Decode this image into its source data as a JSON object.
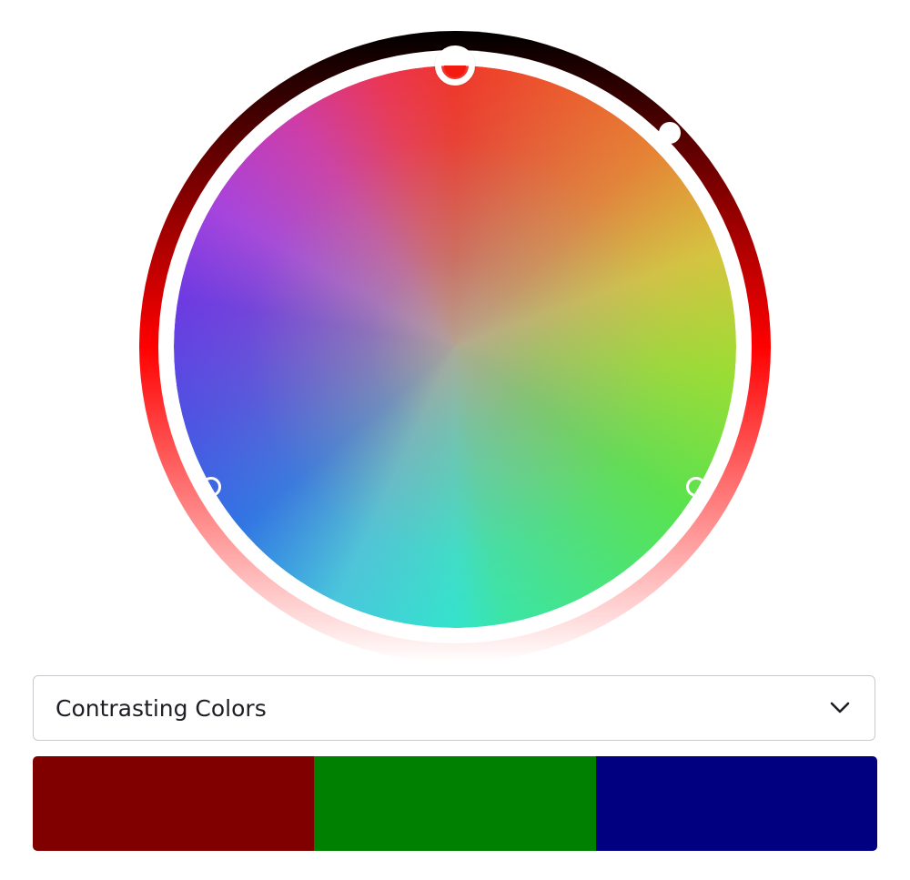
{
  "color_wheel": {
    "selected_hue_color": "#f31a10",
    "shade_ring_colors": [
      "#000000",
      "#ff0000",
      "#ffffff"
    ]
  },
  "scheme_dropdown": {
    "selected": "Contrasting Colors",
    "icon": "chevron-down-icon"
  },
  "palette": {
    "swatches": [
      {
        "color": "#800000"
      },
      {
        "color": "#008000"
      },
      {
        "color": "#000080"
      }
    ]
  }
}
